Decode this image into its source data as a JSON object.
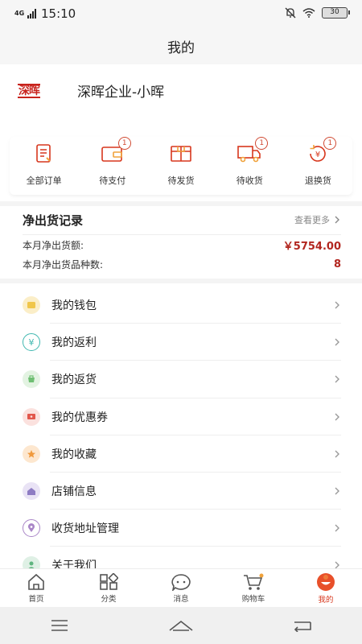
{
  "status": {
    "network": "4G",
    "time": "15:10",
    "battery": "30"
  },
  "nav": {
    "title": "我的"
  },
  "profile": {
    "logo_text": "深晖",
    "name": "深晖企业-小晖"
  },
  "orders": [
    {
      "label": "全部订单",
      "icon": "order-list-icon",
      "badge": ""
    },
    {
      "label": "待支付",
      "icon": "wallet-pay-icon",
      "badge": "1"
    },
    {
      "label": "待发货",
      "icon": "package-icon",
      "badge": ""
    },
    {
      "label": "待收货",
      "icon": "truck-icon",
      "badge": "1"
    },
    {
      "label": "退换货",
      "icon": "refund-icon",
      "badge": "1"
    }
  ],
  "records": {
    "title": "净出货记录",
    "more": "查看更多",
    "rows": [
      {
        "label": "本月净出货额:",
        "value": "￥5754.00"
      },
      {
        "label": "本月净出货品种数:",
        "value": "8"
      }
    ]
  },
  "menu": [
    {
      "label": "我的钱包",
      "icon": "wallet-icon",
      "color": "#f0c64b"
    },
    {
      "label": "我的返利",
      "icon": "rebate-icon",
      "color": "#3fb7b0"
    },
    {
      "label": "我的返货",
      "icon": "return-goods-icon",
      "color": "#6fbf73"
    },
    {
      "label": "我的优惠券",
      "icon": "coupon-icon",
      "color": "#e2574c"
    },
    {
      "label": "我的收藏",
      "icon": "star-icon",
      "color": "#f09a3e"
    },
    {
      "label": "店铺信息",
      "icon": "shop-icon",
      "color": "#8e7cc3"
    },
    {
      "label": "收货地址管理",
      "icon": "location-icon",
      "color": "#a985c7"
    },
    {
      "label": "关于我们",
      "icon": "about-icon",
      "color": "#5fb57f"
    }
  ],
  "tabs": [
    {
      "label": "首页",
      "icon": "home-icon",
      "active": false
    },
    {
      "label": "分类",
      "icon": "category-icon",
      "active": false
    },
    {
      "label": "消息",
      "icon": "message-icon",
      "active": false
    },
    {
      "label": "购物车",
      "icon": "cart-icon",
      "active": false
    },
    {
      "label": "我的",
      "icon": "profile-icon",
      "active": true
    }
  ],
  "colors": {
    "accent": "#d7371d",
    "price": "#b2261f"
  }
}
